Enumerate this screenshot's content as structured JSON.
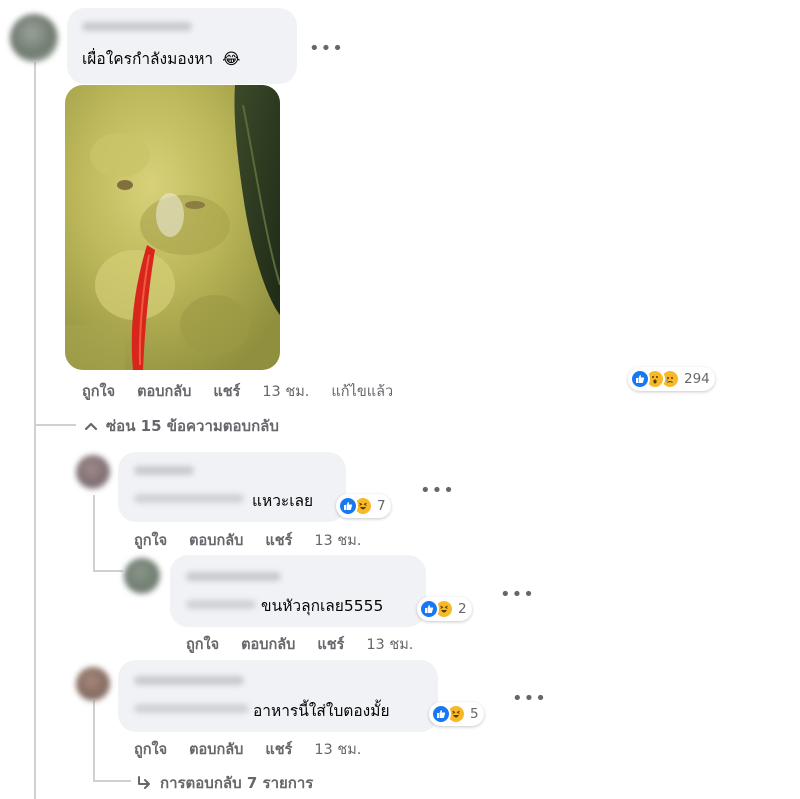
{
  "top_comment": {
    "text": "เผื่อใครกำลังมองหา",
    "emoji": "😂",
    "photo_icon": "green-curry-photo",
    "actions": {
      "like": "ถูกใจ",
      "reply": "ตอบกลับ",
      "share": "แชร์",
      "time": "13 ชม.",
      "edited": "แก้ไขแล้ว"
    },
    "reactions": {
      "icons": [
        "like-icon",
        "wow-icon",
        "sad-icon"
      ],
      "count": "294"
    }
  },
  "hide_replies": {
    "label": "ซ่อน 15 ข้อความตอบกลับ"
  },
  "replies": [
    {
      "text": "แหวะเลย",
      "actions": {
        "like": "ถูกใจ",
        "reply": "ตอบกลับ",
        "share": "แชร์",
        "time": "13 ชม."
      },
      "reactions": {
        "icons": [
          "like-icon",
          "haha-icon"
        ],
        "count": "7"
      }
    },
    {
      "text": "ขนหัวลุกเลย5555",
      "actions": {
        "like": "ถูกใจ",
        "reply": "ตอบกลับ",
        "share": "แชร์",
        "time": "13 ชม."
      },
      "reactions": {
        "icons": [
          "like-icon",
          "haha-icon"
        ],
        "count": "2"
      }
    },
    {
      "text": "อาหารนี้ใส่ใบตองมั้ย",
      "actions": {
        "like": "ถูกใจ",
        "reply": "ตอบกลับ",
        "share": "แชร์",
        "time": "13 ชม."
      },
      "reactions": {
        "icons": [
          "like-icon",
          "haha-icon"
        ],
        "count": "5"
      }
    }
  ],
  "more_replies": {
    "label": "การตอบกลับ 7 รายการ"
  },
  "colors": {
    "bubble": "#f0f2f5",
    "meta_text": "#65676b",
    "like_blue": "#1877f2",
    "emoji_yellow": "#f7b928"
  }
}
